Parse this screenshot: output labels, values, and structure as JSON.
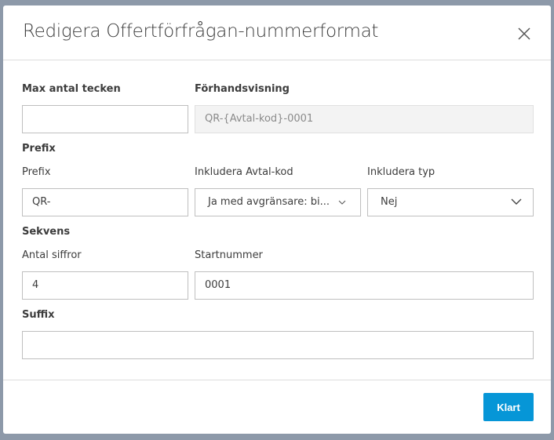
{
  "dialog": {
    "title": "Redigera Offertförfrågan-nummerformat",
    "close_icon": "close-icon"
  },
  "fields": {
    "max_label": "Max antal tecken",
    "max_value": "",
    "preview_label": "Förhandsvisning",
    "preview_value": "QR-{Avtal-kod}-0001",
    "prefix_section": "Prefix",
    "prefix_label": "Prefix",
    "prefix_value": "QR-",
    "include_code_label": "Inkludera Avtal-kod",
    "include_code_value": "Ja med avgränsare: bi...",
    "include_type_label": "Inkludera typ",
    "include_type_value": "Nej",
    "sequence_section": "Sekvens",
    "digits_label": "Antal siffror",
    "digits_value": "4",
    "start_label": "Startnummer",
    "start_value": "0001",
    "suffix_section": "Suffix",
    "suffix_value": ""
  },
  "footer": {
    "done_label": "Klart",
    "accent": "#0696d7"
  }
}
